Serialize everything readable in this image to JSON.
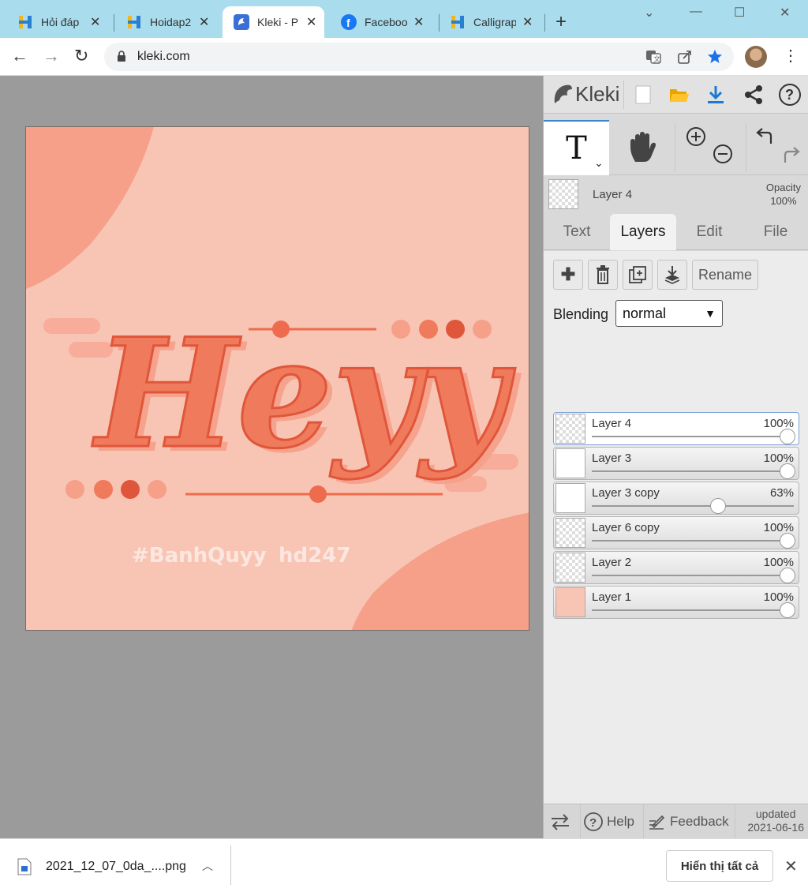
{
  "browser": {
    "tabs": [
      {
        "title": "Hỏi đáp",
        "icon": "hoidap-icon",
        "active": false
      },
      {
        "title": "Hoidap2",
        "icon": "hoidap-icon",
        "active": false
      },
      {
        "title": "Kleki - P",
        "icon": "kleki-icon",
        "active": true
      },
      {
        "title": "Faceboo",
        "icon": "facebook-icon",
        "active": false
      },
      {
        "title": "Calligrap",
        "icon": "hoidap-icon",
        "active": false
      }
    ],
    "url": "kleki.com"
  },
  "artwork": {
    "main_text": "Heyy",
    "hashtag": "#BanhQuyy",
    "signature": "hd247",
    "colors": {
      "background": "#f8c5b5",
      "accent": "#f07a5c",
      "dark_accent": "#e0563a",
      "blob": "#f6a08a"
    }
  },
  "panel": {
    "brand": "Kleki",
    "current_layer": {
      "name": "Layer 4",
      "opacity_label": "Opacity",
      "opacity_value": "100%"
    },
    "tabs": [
      "Text",
      "Layers",
      "Edit",
      "File"
    ],
    "active_tab": "Layers",
    "rename_label": "Rename",
    "blending_label": "Blending",
    "blending_value": "normal",
    "layers": [
      {
        "name": "Layer 4",
        "opacity": "100%",
        "value": 1.0,
        "selected": true
      },
      {
        "name": "Layer 3",
        "opacity": "100%",
        "value": 1.0,
        "selected": false
      },
      {
        "name": "Layer 3 copy",
        "opacity": "63%",
        "value": 0.63,
        "selected": false
      },
      {
        "name": "Layer 6 copy",
        "opacity": "100%",
        "value": 1.0,
        "selected": false
      },
      {
        "name": "Layer 2",
        "opacity": "100%",
        "value": 1.0,
        "selected": false
      },
      {
        "name": "Layer 1",
        "opacity": "100%",
        "value": 1.0,
        "selected": false
      }
    ],
    "footer": {
      "help": "Help",
      "feedback": "Feedback",
      "updated_label": "updated",
      "updated_date": "2021-06-16"
    }
  },
  "downloads": {
    "file": "2021_12_07_0da_....png",
    "show_all": "Hiển thị tất cả"
  }
}
